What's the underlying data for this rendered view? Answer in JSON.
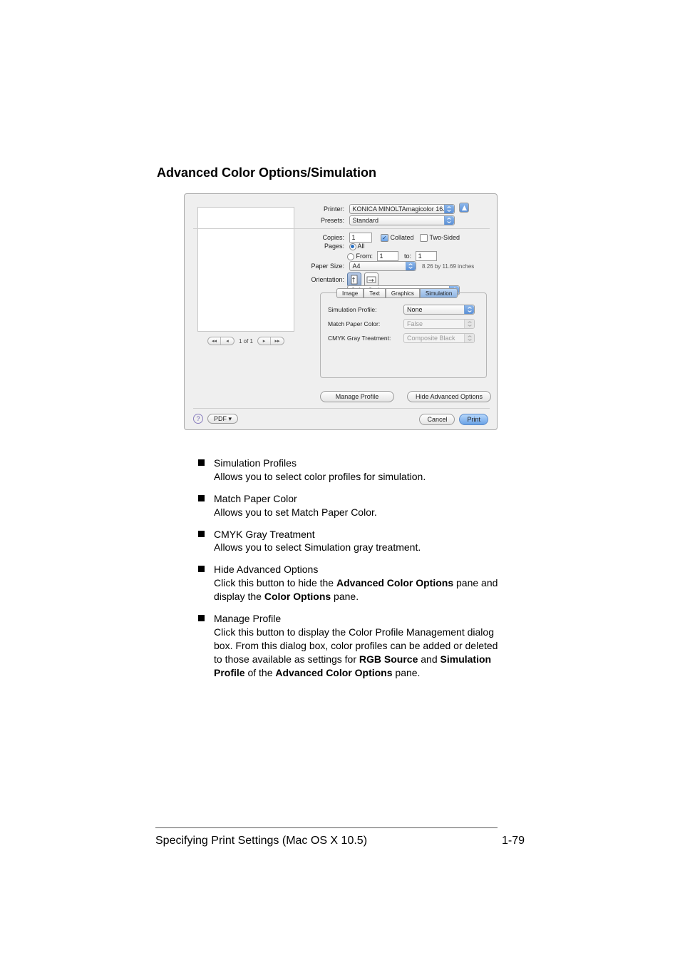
{
  "heading": "Advanced Color Options/Simulation",
  "dialog": {
    "printer_label": "Printer:",
    "printer_value": "KONICA MINOLTAmagicolor 16...",
    "presets_label": "Presets:",
    "presets_value": "Standard",
    "copies_label": "Copies:",
    "copies_value": "1",
    "collated_label": "Collated",
    "twosided_label": "Two-Sided",
    "pages_label": "Pages:",
    "pages_all_label": "All",
    "pages_from_label": "From:",
    "pages_from_value": "1",
    "pages_to_label": "to:",
    "pages_to_value": "1",
    "paper_size_label": "Paper Size:",
    "paper_size_value": "A4",
    "paper_dim": "8.26 by 11.69 inches",
    "orientation_label": "Orientation:",
    "section_select": "Color Options",
    "tabs": [
      "Image",
      "Text",
      "Graphics",
      "Simulation"
    ],
    "sim_profile_label": "Simulation Profile:",
    "sim_profile_value": "None",
    "match_paper_label": "Match Paper Color:",
    "match_paper_value": "False",
    "cmyk_gray_label": "CMYK Gray Treatment:",
    "cmyk_gray_value": "Composite Black",
    "manage_profile": "Manage Profile",
    "hide_adv": "Hide Advanced Options",
    "pager_text": "1 of 1",
    "pdf_btn": "PDF ▾",
    "cancel": "Cancel",
    "print": "Print"
  },
  "items": [
    {
      "title": "Simulation Profiles",
      "desc": "Allows you to select color profiles for simulation."
    },
    {
      "title": "Match Paper Color",
      "desc": "Allows you to set Match Paper Color."
    },
    {
      "title": "CMYK Gray Treatment",
      "desc": "Allows you to select Simulation gray treatment."
    },
    {
      "title": "Hide Advanced Options",
      "desc_html": "Click this button to hide the <b>Advanced Color Options</b> pane and display the <b>Color Options</b> pane."
    },
    {
      "title": "Manage Profile",
      "desc_html": "Click this button to display the Color Profile Management dialog box. From this dialog box, color profiles can be added or deleted to those available as settings for <b>RGB Source</b> and <b>Simulation Profile</b> of the <b>Advanced Color Options</b> pane."
    }
  ],
  "footer": {
    "left": "Specifying Print Settings (Mac OS X 10.5)",
    "right": "1-79"
  }
}
